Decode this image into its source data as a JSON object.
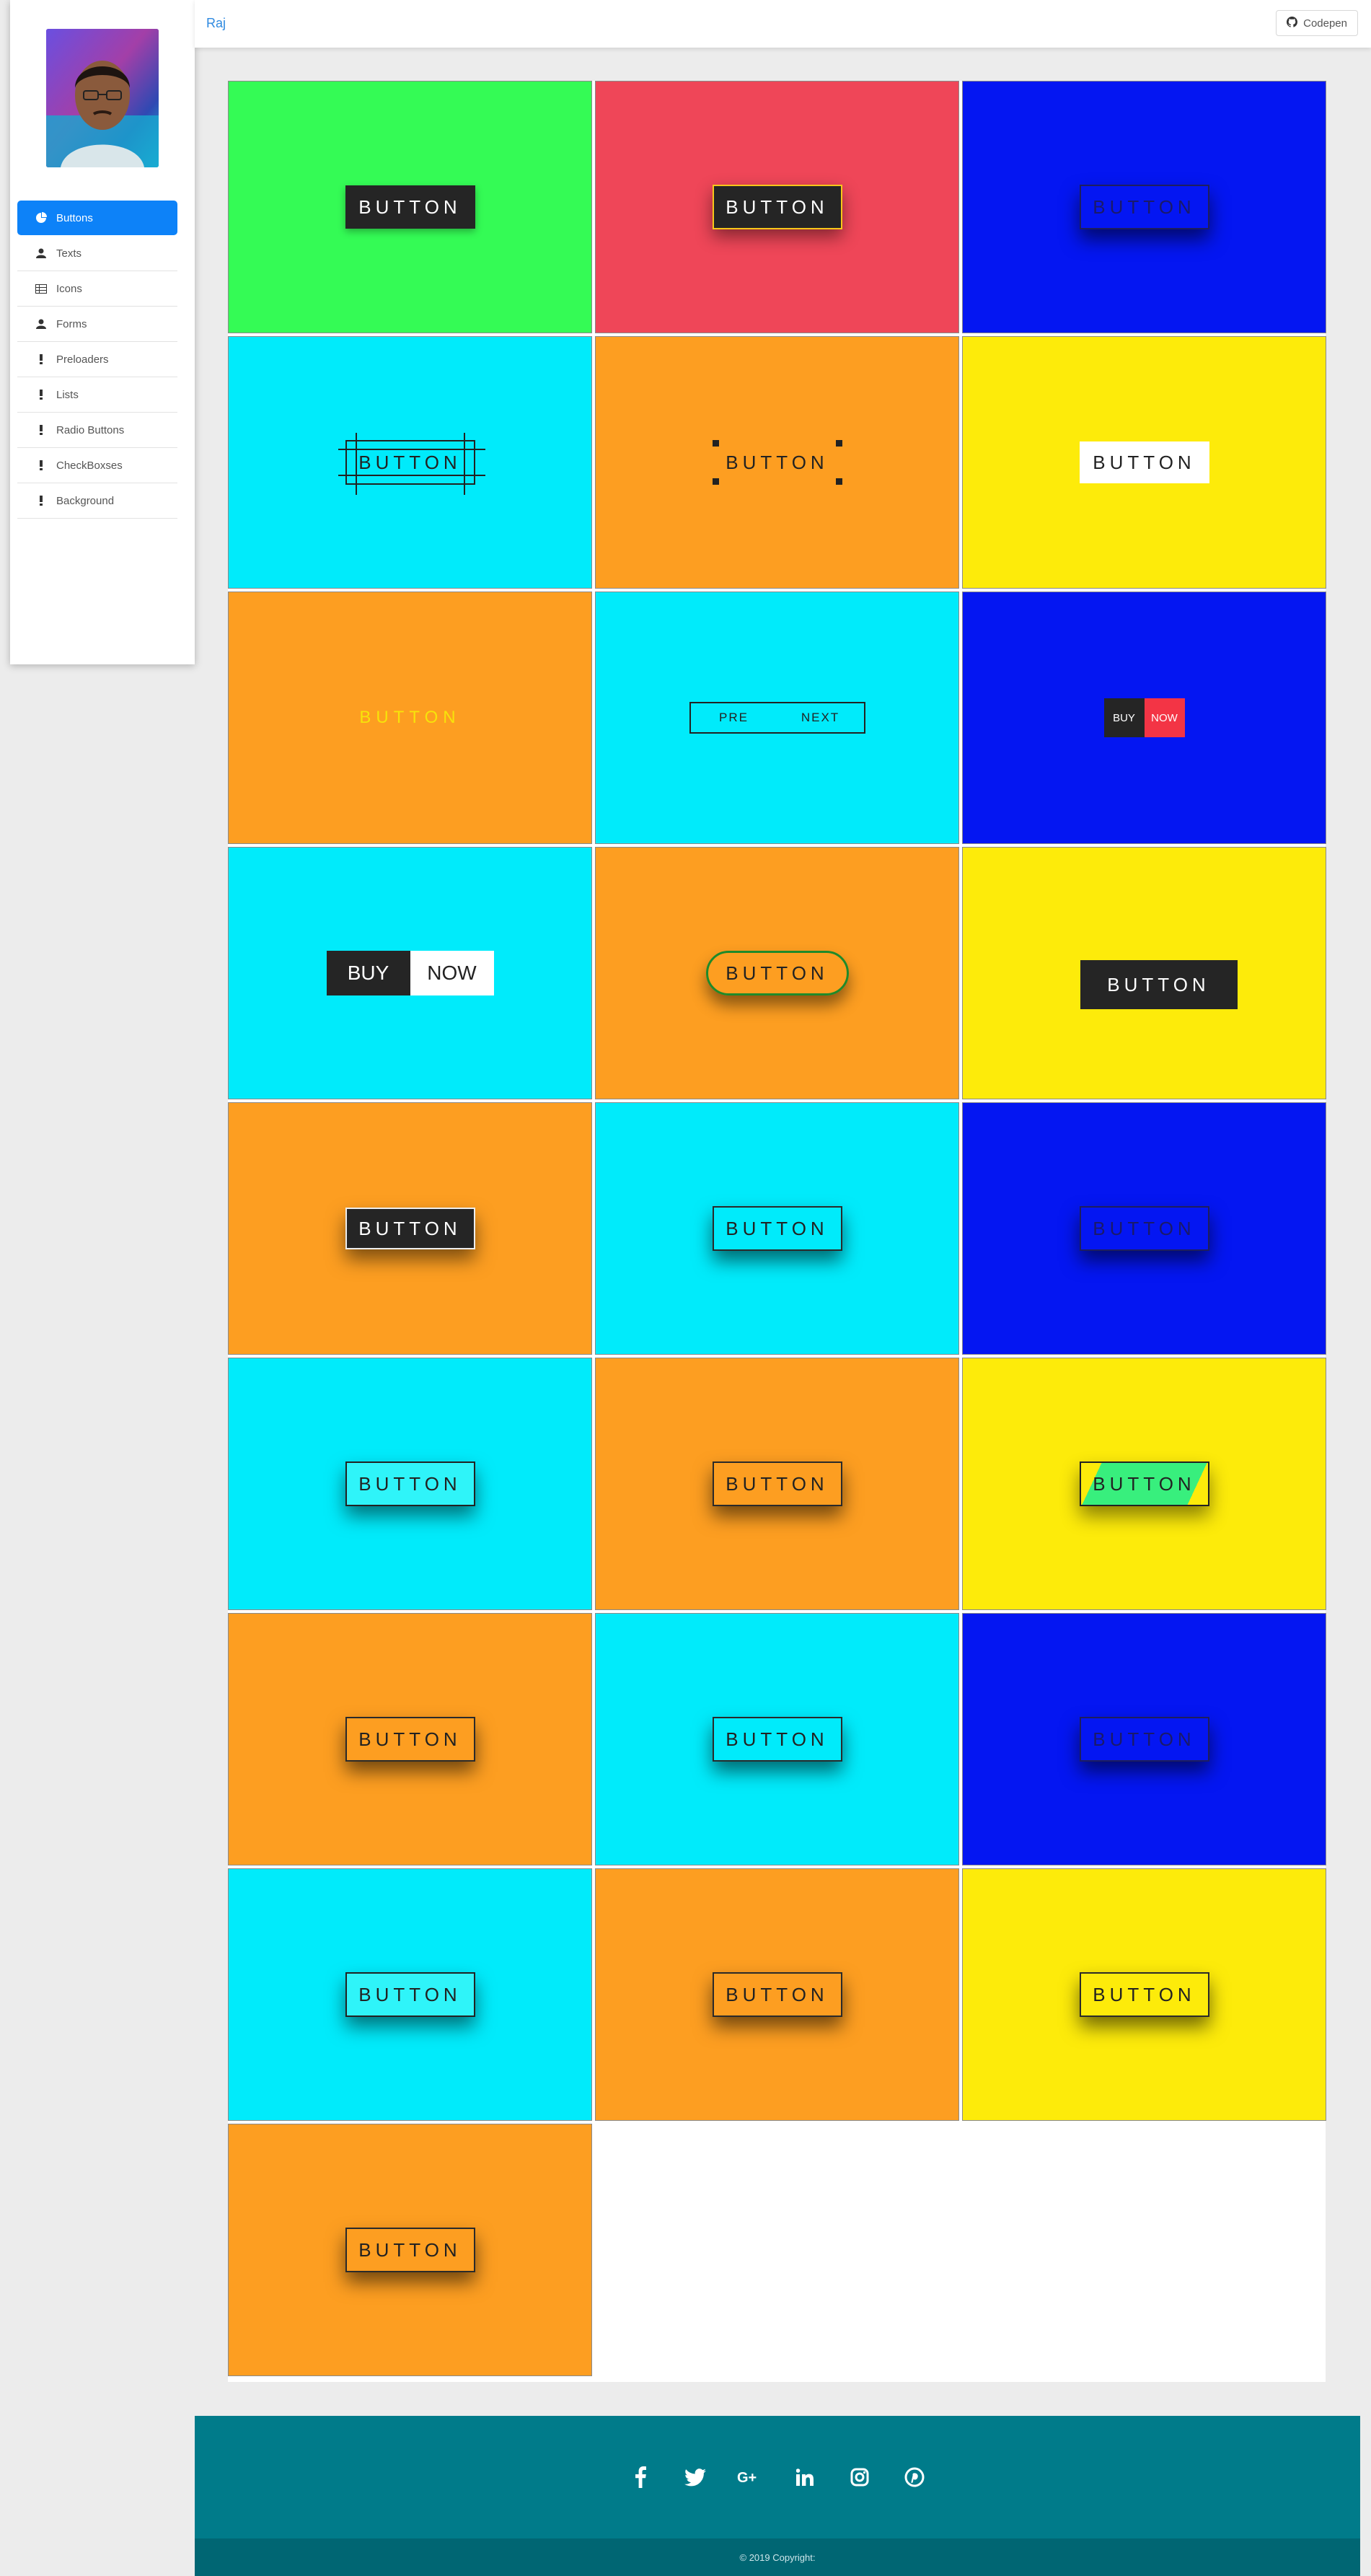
{
  "header": {
    "brand": "Raj",
    "codepen_label": "Codepen"
  },
  "sidebar": {
    "items": [
      {
        "label": "Buttons",
        "icon": "pie-chart-icon",
        "active": true
      },
      {
        "label": "Texts",
        "icon": "user-icon"
      },
      {
        "label": "Icons",
        "icon": "table-icon"
      },
      {
        "label": "Forms",
        "icon": "user-icon"
      },
      {
        "label": "Preloaders",
        "icon": "exclamation-icon"
      },
      {
        "label": "Lists",
        "icon": "exclamation-icon"
      },
      {
        "label": "Radio Buttons",
        "icon": "exclamation-icon"
      },
      {
        "label": "CheckBoxses",
        "icon": "exclamation-icon"
      },
      {
        "label": "Background",
        "icon": "exclamation-icon"
      }
    ]
  },
  "tiles": {
    "button_label": "BUTTON",
    "pre": "PRE",
    "next": "NEXT",
    "buy": "BUY",
    "now": "NOW"
  },
  "colors": {
    "green": "#34fb55",
    "red": "#ef4658",
    "blue": "#0416f2",
    "cyan": "#00ebfb",
    "orange": "#fd9e21",
    "yellow": "#fdeb0a",
    "accent": "#0d82f8",
    "footer": "#007b8a"
  },
  "footer": {
    "social": [
      "facebook-icon",
      "twitter-icon",
      "google-plus-icon",
      "linkedin-icon",
      "instagram-icon",
      "pinterest-icon"
    ],
    "copyright": "© 2019 Copyright:"
  }
}
